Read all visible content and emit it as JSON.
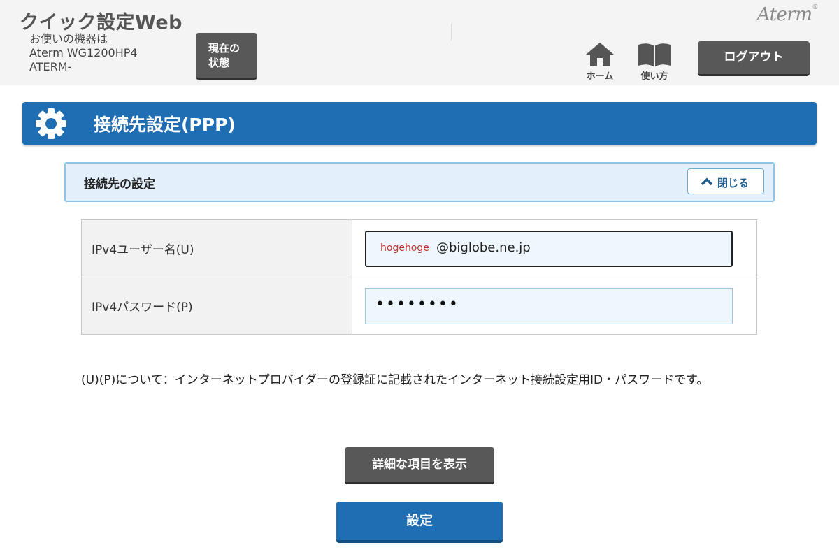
{
  "header": {
    "app_title": "クイック設定Web",
    "device_lines": [
      "お使いの機器は",
      "Aterm WG1200HP4",
      "ATERM-"
    ],
    "status_button": [
      "現在の",
      "状態"
    ],
    "brand": "Aterm",
    "nav": {
      "home_label": "ホーム",
      "help_label": "使い方"
    },
    "logout_label": "ログアウト"
  },
  "section": {
    "title": "接続先設定(PPP)"
  },
  "panel": {
    "title": "接続先の設定",
    "close_label": "閉じる"
  },
  "form": {
    "username_label": "IPv4ユーザー名(U)",
    "username_prefix": "hogehoge",
    "username_domain": "@biglobe.ne.jp",
    "password_label": "IPv4パスワード(P)",
    "password_value": "••••••••"
  },
  "note": "(U)(P)について：インターネットプロバイダーの登録証に記載されたインターネット接続設定用ID・パスワードです。",
  "buttons": {
    "detail_label": "詳細な項目を表示",
    "submit_label": "設定"
  },
  "colors": {
    "primary_blue": "#1f6db3",
    "dark_button": "#585858",
    "panel_bg": "#e3f0fb"
  }
}
